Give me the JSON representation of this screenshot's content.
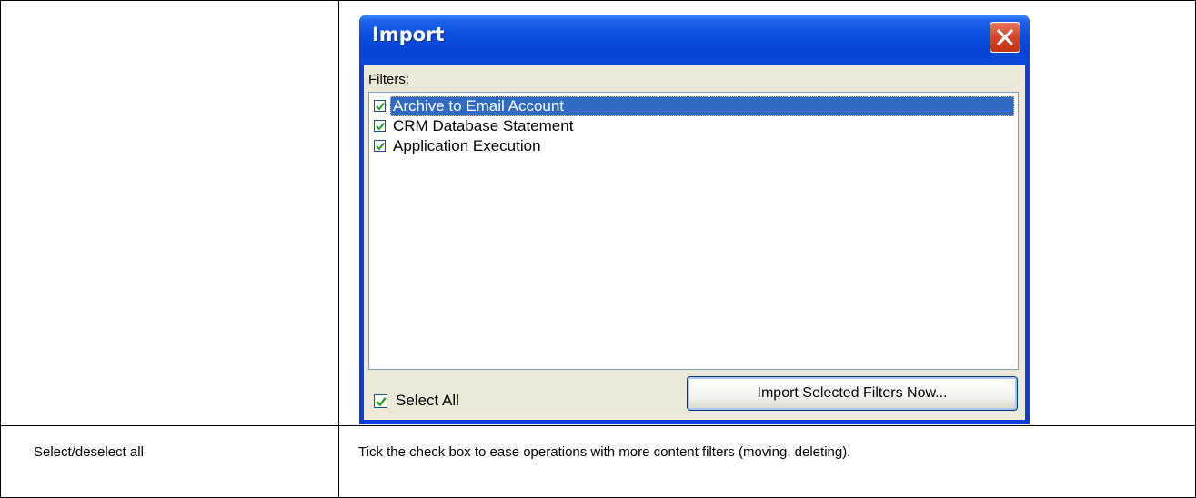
{
  "table": {
    "row2": {
      "label": "Select/deselect all",
      "description": "Tick the check box to ease operations with more content filters (moving, deleting)."
    }
  },
  "dialog": {
    "title": "Import",
    "close_icon": "close-icon",
    "filters_label": "Filters:",
    "filters": [
      {
        "label": "Archive to Email Account",
        "checked": true,
        "selected": true
      },
      {
        "label": "CRM Database Statement",
        "checked": true,
        "selected": false
      },
      {
        "label": "Application Execution",
        "checked": true,
        "selected": false
      }
    ],
    "select_all": {
      "label": "Select All",
      "checked": true
    },
    "import_button": "Import Selected Filters Now..."
  },
  "colors": {
    "titlebar": "#0a4fe0",
    "client": "#ece9d8",
    "selection": "#316ac5",
    "close_button": "#d5422a",
    "checkmark": "#21a121"
  }
}
